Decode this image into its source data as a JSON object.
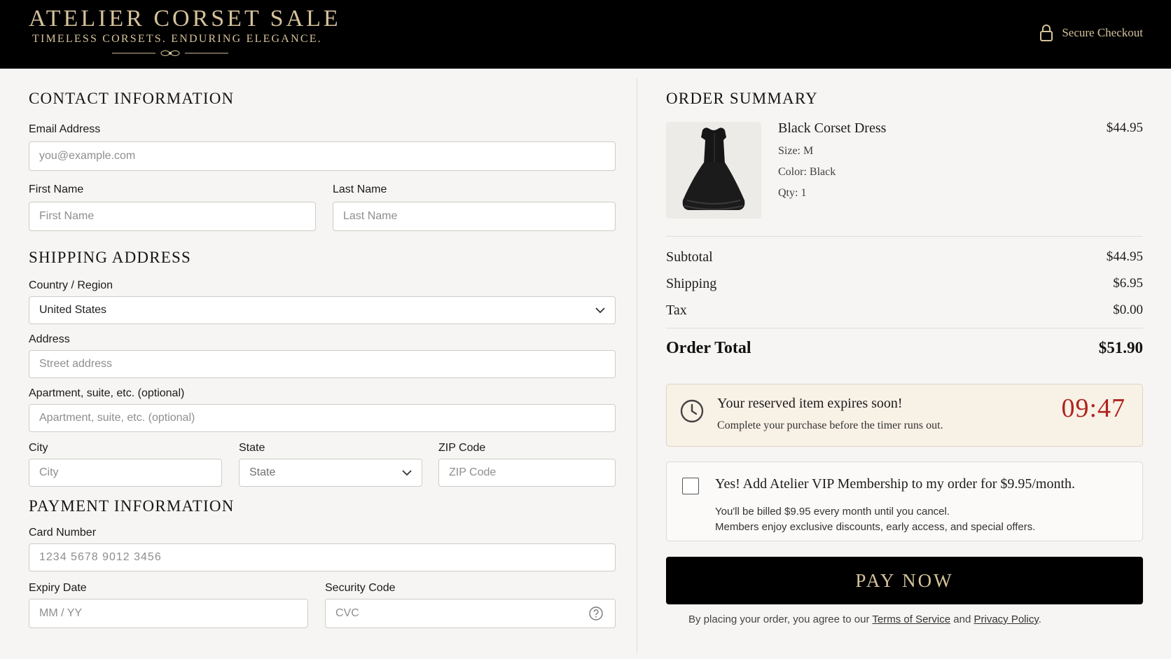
{
  "header": {
    "brand_title": "ATELIER CORSET SALE",
    "brand_tagline": "TIMELESS CORSETS. ENDURING ELEGANCE.",
    "secure_label": "Secure Checkout"
  },
  "contact": {
    "heading": "CONTACT INFORMATION",
    "email_label": "Email Address",
    "email_placeholder": "you@example.com",
    "first_name_label": "First Name",
    "first_name_placeholder": "First Name",
    "last_name_label": "Last Name",
    "last_name_placeholder": "Last Name"
  },
  "shipping": {
    "heading": "SHIPPING ADDRESS",
    "country_label": "Country / Region",
    "country_value": "United States",
    "address_label": "Address",
    "address_placeholder": "Street address",
    "apt_label": "Apartment, suite, etc. (optional)",
    "apt_placeholder": "Apartment, suite, etc. (optional)",
    "city_label": "City",
    "city_placeholder": "City",
    "state_label": "State",
    "state_value": "State",
    "zip_label": "ZIP Code",
    "zip_placeholder": "ZIP Code"
  },
  "payment": {
    "heading": "PAYMENT INFORMATION",
    "card_label": "Card Number",
    "card_placeholder": "1234 5678 9012 3456",
    "expiry_label": "Expiry Date",
    "expiry_placeholder": "MM / YY",
    "cvc_label": "Security Code",
    "cvc_placeholder": "CVC"
  },
  "summary": {
    "heading": "ORDER SUMMARY",
    "item": {
      "name": "Black Corset Dress",
      "price": "$44.95",
      "size": "Size: M",
      "color": "Color: Black",
      "qty": "Qty: 1"
    },
    "subtotal_label": "Subtotal",
    "subtotal_value": "$44.95",
    "shipping_label": "Shipping",
    "shipping_value": "$6.95",
    "tax_label": "Tax",
    "tax_value": "$0.00",
    "total_label": "Order Total",
    "total_value": "$51.90"
  },
  "timer": {
    "title": "Your reserved item expires soon!",
    "subtitle": "Complete your purchase before the timer runs out.",
    "countdown": "09:47"
  },
  "vip": {
    "title": "Yes! Add Atelier VIP Membership to my order for $9.95/month.",
    "line1": "You'll be billed $9.95 every month until you cancel.",
    "line2": "Members enjoy exclusive discounts, early access, and special offers.",
    "checked": false
  },
  "checkout": {
    "pay_label": "PAY NOW",
    "legal_prefix": "By placing your order, you agree to our",
    "terms_link": "Terms of Service",
    "legal_and": "and",
    "privacy_link": "Privacy Policy",
    "legal_suffix": "."
  },
  "colors": {
    "gold": "#d6c29a",
    "header_bg": "#000000",
    "timer_red": "#b0231f",
    "timer_bg": "#f8f1e6"
  }
}
